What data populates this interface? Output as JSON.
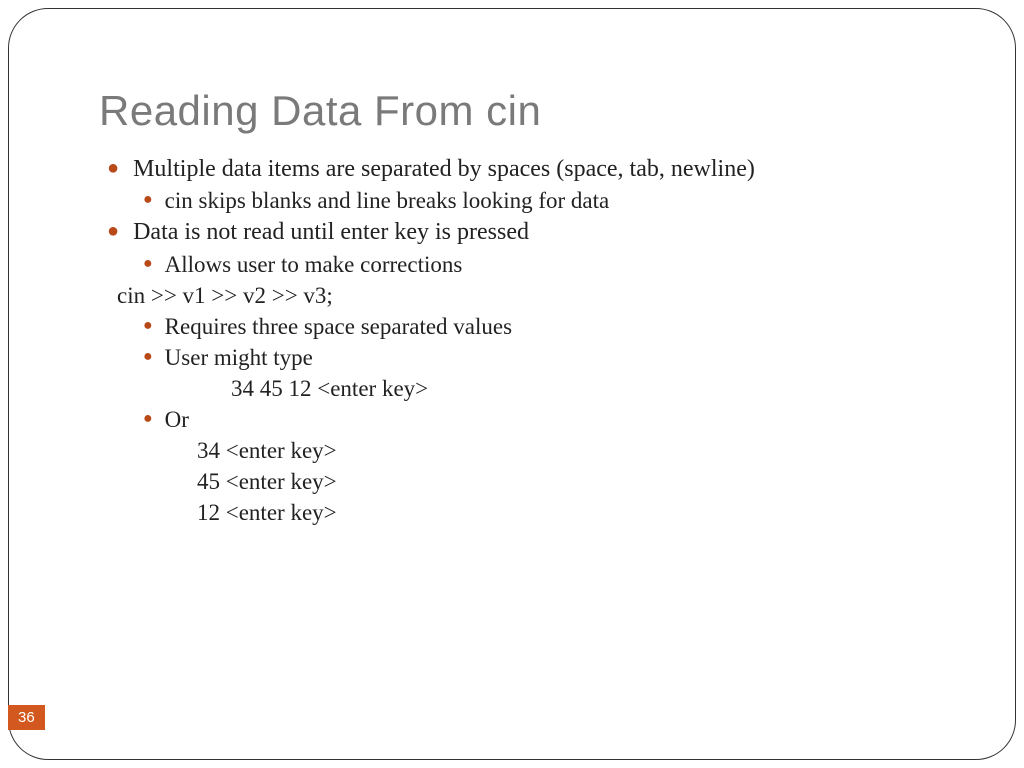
{
  "slide": {
    "title": "Reading Data From cin",
    "page_number": "36",
    "bullets": {
      "b1": "Multiple data items are separated by spaces (space, tab, newline)",
      "b1_1": "cin skips blanks and line breaks looking for data",
      "b2": "Data is not read until enter key is pressed",
      "b2_1": "Allows user to make corrections",
      "code_line": "cin >> v1 >> v2 >> v3;",
      "b3_1": "Requires three space separated values",
      "b3_2": "User might type",
      "example1": "34  45  12   <enter key>",
      "b3_3": "Or",
      "example2_l1": "34  <enter key>",
      "example2_l2": "45 <enter key>",
      "example2_l3": "12   <enter key>"
    }
  }
}
